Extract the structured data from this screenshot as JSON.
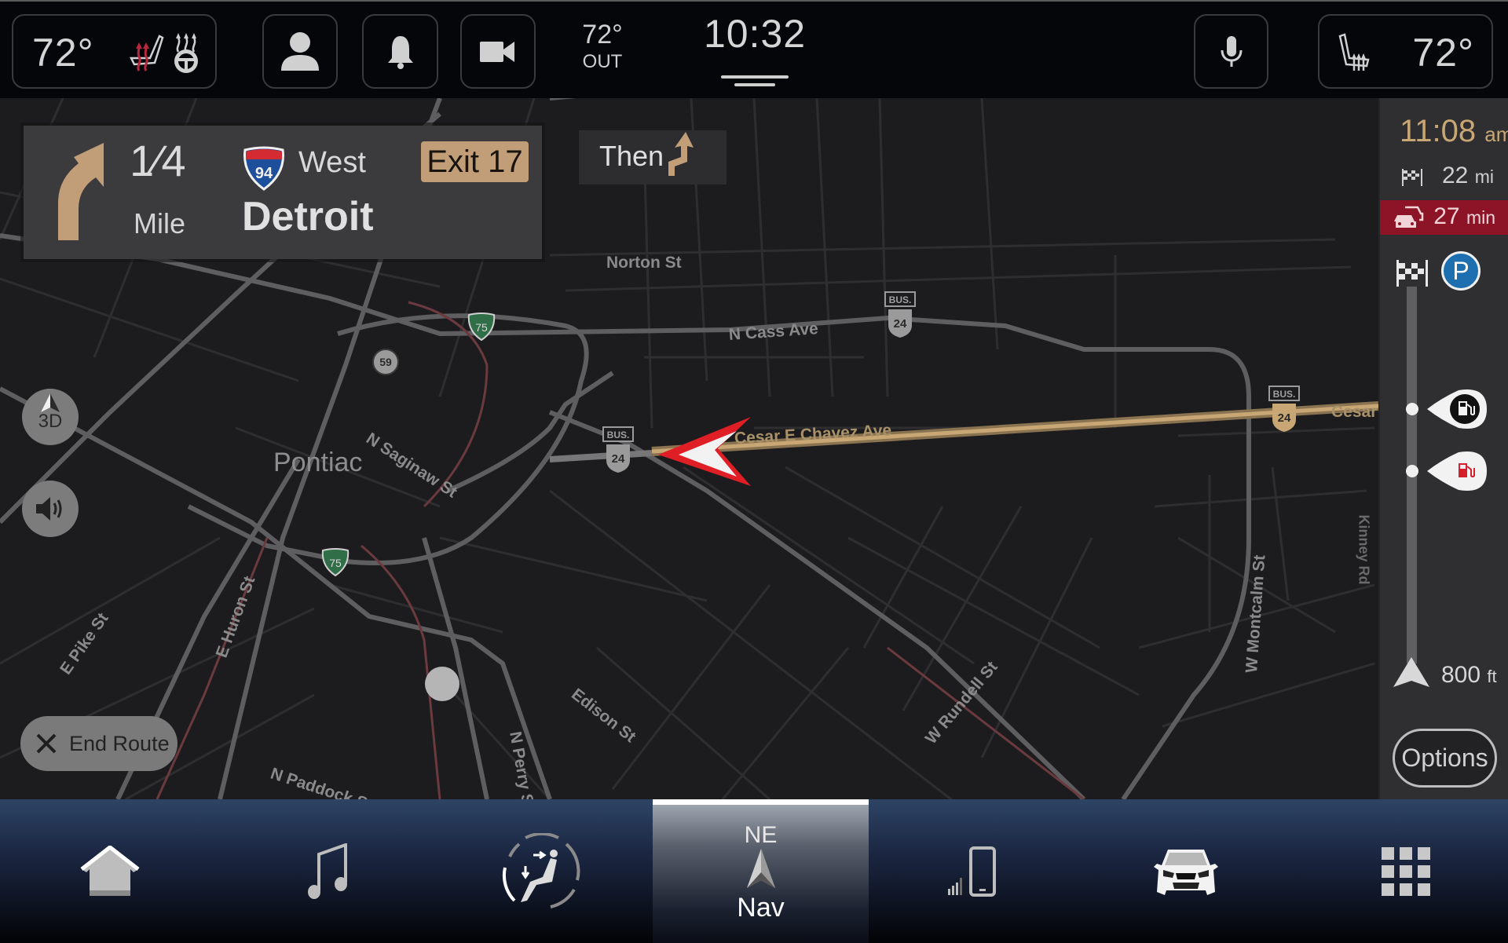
{
  "top_bar": {
    "driver_temp": "72°",
    "passenger_temp": "72°",
    "outside_temp": "72°",
    "outside_label": "OUT",
    "clock": "10:32",
    "icons": {
      "seat_heat": "seat-heat-icon",
      "steering_heat": "steering-wheel-heat-icon",
      "profile": "person-icon",
      "notifications": "bell-icon",
      "camera": "video-camera-icon",
      "voice": "microphone-icon",
      "passenger_seat_vent": "seat-vent-icon"
    },
    "seat_heat_color": "#b8283c"
  },
  "maneuver": {
    "distance": "1⁄4",
    "distance_unit": "Mile",
    "highway_shield": "94",
    "direction": "West",
    "destination": "Detroit",
    "exit": "Exit 17",
    "then_label": "Then",
    "accent_color": "#c29e78"
  },
  "map": {
    "city": "Pontiac",
    "streets": [
      "Norton St",
      "N Cass Ave",
      "N Saginaw St",
      "Cesar E Chavez Ave",
      "Cesar",
      "E Pike St",
      "E Huron St",
      "N Paddock St",
      "N Perry St",
      "Edison St",
      "W Rundell St",
      "W Montcalm St",
      "Kinney Rd"
    ],
    "shields": {
      "i75_a": "75",
      "i75_b": "75",
      "m59": "59",
      "bus24_a": "24",
      "bus24_b": "24",
      "bus24_c": "24",
      "bus_label": "BUS."
    },
    "controls": {
      "view_mode": "3D",
      "end_route": "End Route"
    },
    "route_color": "#c9a774",
    "vehicle_color": "#e01e25"
  },
  "sidebar": {
    "eta": "11:08",
    "eta_ampm": "am",
    "distance": "22",
    "distance_unit": "mi",
    "duration": "27",
    "duration_unit": "min",
    "traffic_color": "#8c1426",
    "parking": "P",
    "next_distance": "800",
    "next_distance_unit": "ft",
    "options": "Options"
  },
  "bottom_nav": {
    "items": [
      {
        "id": "home",
        "icon": "home-icon"
      },
      {
        "id": "media",
        "icon": "music-note-icon"
      },
      {
        "id": "comfort",
        "icon": "seat-comfort-icon"
      },
      {
        "id": "nav",
        "heading": "NE",
        "label": "Nav",
        "icon": "compass-arrow-icon",
        "active": true
      },
      {
        "id": "phone",
        "icon": "phone-icon"
      },
      {
        "id": "vehicle",
        "icon": "car-icon"
      },
      {
        "id": "apps",
        "icon": "apps-grid-icon"
      }
    ]
  }
}
